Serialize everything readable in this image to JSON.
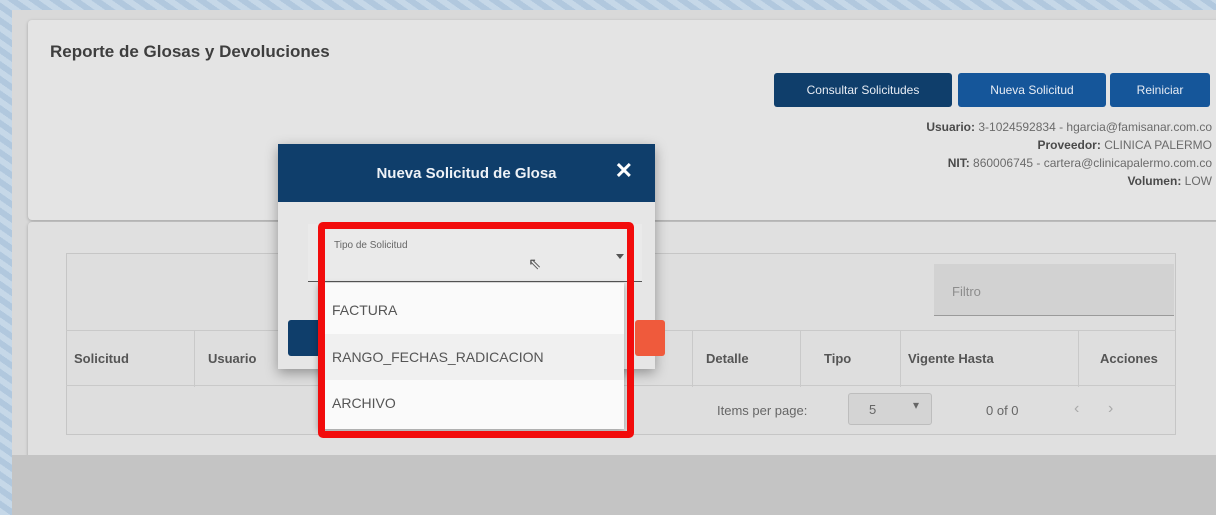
{
  "page": {
    "title": "Reporte de Glosas y Devoluciones"
  },
  "toolbar": {
    "consultar": "Consultar Solicitudes",
    "nueva": "Nueva Solicitud",
    "reiniciar": "Reiniciar"
  },
  "user_info": {
    "usuario_label": "Usuario:",
    "usuario_value": "3-1024592834 - hgarcia@famisanar.com.co",
    "proveedor_label": "Proveedor:",
    "proveedor_value": "CLINICA PALERMO",
    "nit_label": "NIT:",
    "nit_value": "860006745 - cartera@clinicapalermo.com.co",
    "volumen_label": "Volumen:",
    "volumen_value": "LOW"
  },
  "table": {
    "filter_placeholder": "Filtro",
    "columns": [
      "Solicitud",
      "Usuario",
      "Detalle",
      "Tipo",
      "Vigente Hasta",
      "Acciones"
    ],
    "paginator": {
      "items_label": "Items per page:",
      "page_size": "5",
      "range": "0 of 0"
    }
  },
  "modal": {
    "title": "Nueva Solicitud de Glosa",
    "field_label": "Tipo de Solicitud",
    "options": [
      "FACTURA",
      "RANGO_FECHAS_RADICACION",
      "ARCHIVO"
    ]
  },
  "colors": {
    "primary": "#0f3e6b",
    "accent_button": "#15569a",
    "highlight": "#f20c0c",
    "danger": "#ef5a3c"
  }
}
